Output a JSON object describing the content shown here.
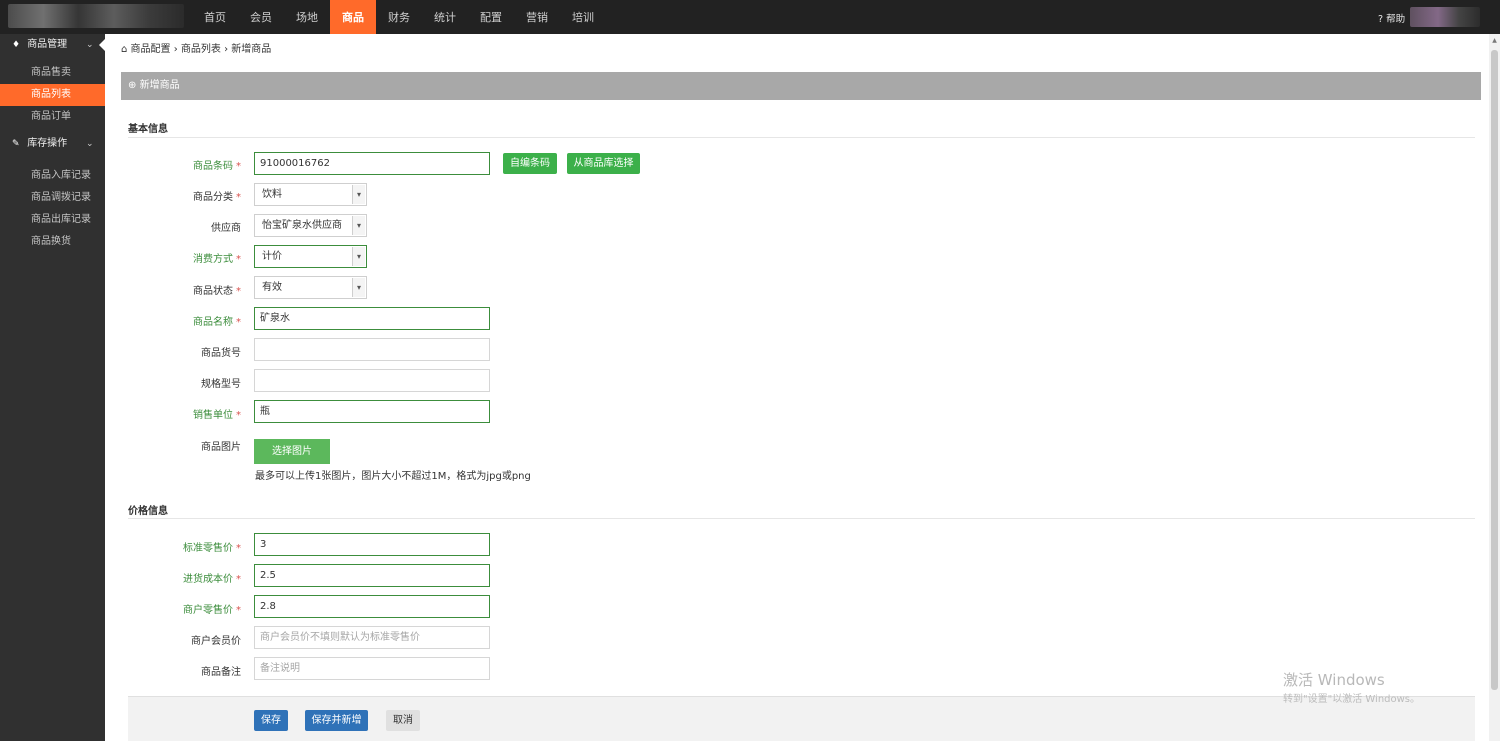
{
  "topnav": {
    "items": [
      {
        "label": "首页"
      },
      {
        "label": "会员"
      },
      {
        "label": "场地"
      },
      {
        "label": "商品"
      },
      {
        "label": "财务"
      },
      {
        "label": "统计"
      },
      {
        "label": "配置"
      },
      {
        "label": "营销"
      },
      {
        "label": "培训"
      }
    ],
    "active_index": 3,
    "help_label": "帮助",
    "accent_color": "#ff6a2a"
  },
  "sidebar": {
    "groups": [
      {
        "label": "商品管理",
        "icon": "gift-icon",
        "items": [
          {
            "label": "商品售卖"
          },
          {
            "label": "商品列表",
            "active": true
          },
          {
            "label": "商品订单"
          }
        ]
      },
      {
        "label": "库存操作",
        "icon": "wrench-icon",
        "items": [
          {
            "label": "商品入库记录"
          },
          {
            "label": "商品调拨记录"
          },
          {
            "label": "商品出库记录"
          },
          {
            "label": "商品换货"
          }
        ]
      }
    ]
  },
  "breadcrumb": {
    "items": [
      "商品配置",
      "商品列表",
      "新增商品"
    ]
  },
  "panel": {
    "title": "新增商品"
  },
  "basic": {
    "section_title": "基本信息",
    "barcode": {
      "label": "商品条码",
      "value": "91000016762",
      "btn_auto": "自编条码",
      "btn_library": "从商品库选择"
    },
    "category": {
      "label": "商品分类",
      "value": "饮料"
    },
    "supplier": {
      "label": "供应商",
      "value": "怡宝矿泉水供应商"
    },
    "consume_mode": {
      "label": "消费方式",
      "value": "计价"
    },
    "status": {
      "label": "商品状态",
      "value": "有效"
    },
    "name": {
      "label": "商品名称",
      "value": "矿泉水"
    },
    "sku": {
      "label": "商品货号",
      "value": ""
    },
    "spec": {
      "label": "规格型号",
      "value": ""
    },
    "unit": {
      "label": "销售单位",
      "value": "瓶"
    },
    "image": {
      "label": "商品图片",
      "button": "选择图片",
      "hint": "最多可以上传1张图片，图片大小不超过1M，格式为jpg或png"
    }
  },
  "price": {
    "section_title": "价格信息",
    "retail": {
      "label": "标准零售价",
      "value": "3"
    },
    "cost": {
      "label": "进货成本价",
      "value": "2.5"
    },
    "merchant_retail": {
      "label": "商户零售价",
      "value": "2.8"
    },
    "member_price": {
      "label": "商户会员价",
      "placeholder": "商户会员价不填则默认为标准零售价"
    },
    "remark": {
      "label": "商品备注",
      "placeholder": "备注说明"
    }
  },
  "actions": {
    "save": "保存",
    "save_new": "保存并新增",
    "cancel": "取消"
  },
  "watermark": {
    "line1": "激活 Windows",
    "line2": "转到\"设置\"以激活 Windows。"
  }
}
